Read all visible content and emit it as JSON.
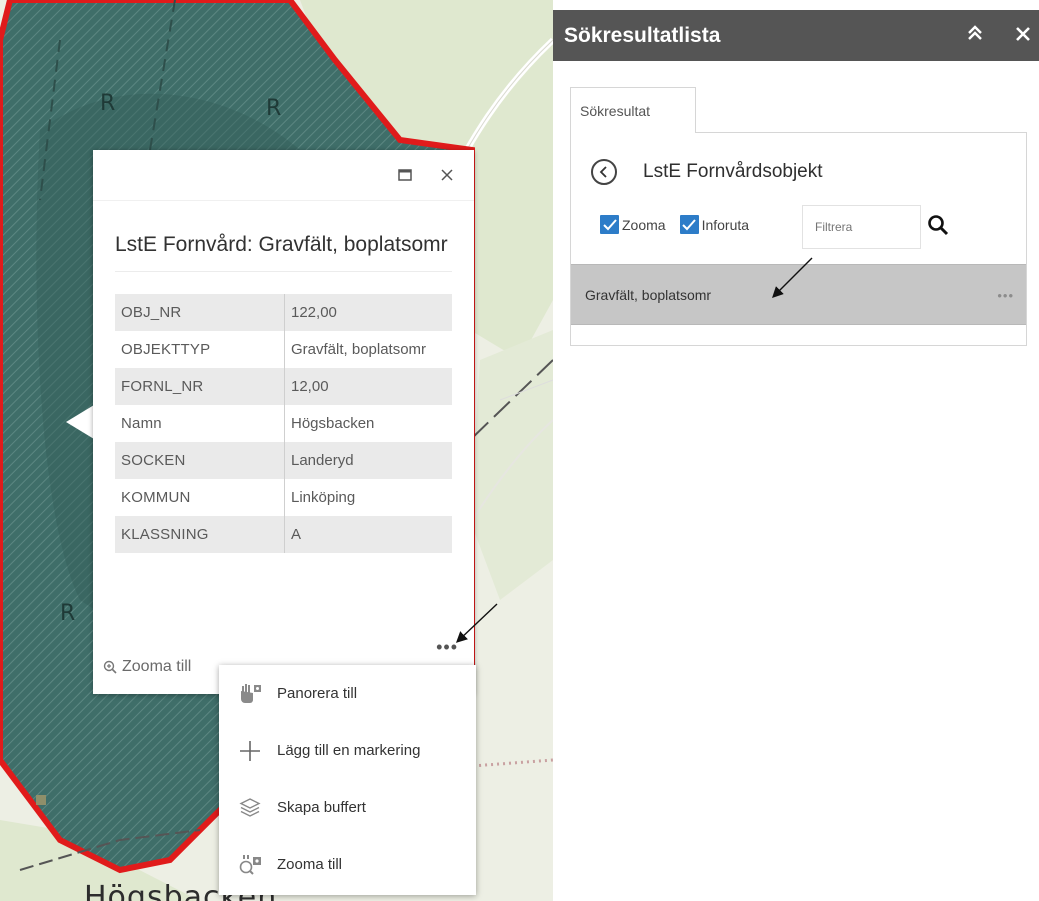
{
  "map": {
    "place_label": "Högsbacken",
    "symbol_letter": "R"
  },
  "popup": {
    "maximize_icon": "window-maximize-icon",
    "close_icon": "close-icon",
    "title": "LstE Fornvård: Gravfält, boplatsomr",
    "attributes": [
      {
        "key": "OBJ_NR",
        "value": "122,00"
      },
      {
        "key": "OBJEKTTYP",
        "value": "Gravfält, boplatsomr"
      },
      {
        "key": "FORNL_NR",
        "value": "12,00"
      },
      {
        "key": "Namn",
        "value": "Högsbacken"
      },
      {
        "key": "SOCKEN",
        "value": "Landeryd"
      },
      {
        "key": "KOMMUN",
        "value": "Linköping"
      },
      {
        "key": "KLASSNING",
        "value": "A"
      }
    ],
    "zoom_label": "Zooma till",
    "more_label": "•••"
  },
  "menu": {
    "items": [
      {
        "label": "Panorera till",
        "icon": "pan-to-icon"
      },
      {
        "label": "Lägg till en markering",
        "icon": "plus-icon"
      },
      {
        "label": "Skapa buffert",
        "icon": "layers-buffer-icon"
      },
      {
        "label": "Zooma till",
        "icon": "zoom-to-icon"
      }
    ]
  },
  "panel": {
    "title": "Sökresultatlista",
    "collapse_icon": "double-chevron-up-icon",
    "close_icon": "close-icon",
    "tab_label": "Sökresultat",
    "layer_title": "LstE Fornvårdsobjekt",
    "zoom_option": "Zooma",
    "popup_option": "Inforuta",
    "filter_placeholder": "Filtrera",
    "result_item": "Gravfält, boplatsomr",
    "result_more": "•••"
  },
  "colors": {
    "header_bg": "#555555",
    "checkbox": "#2d7cc8",
    "feature_outline": "#e01b1b",
    "feature_fill": "#3f6f6a",
    "selected_row": "#c6c6c6"
  }
}
